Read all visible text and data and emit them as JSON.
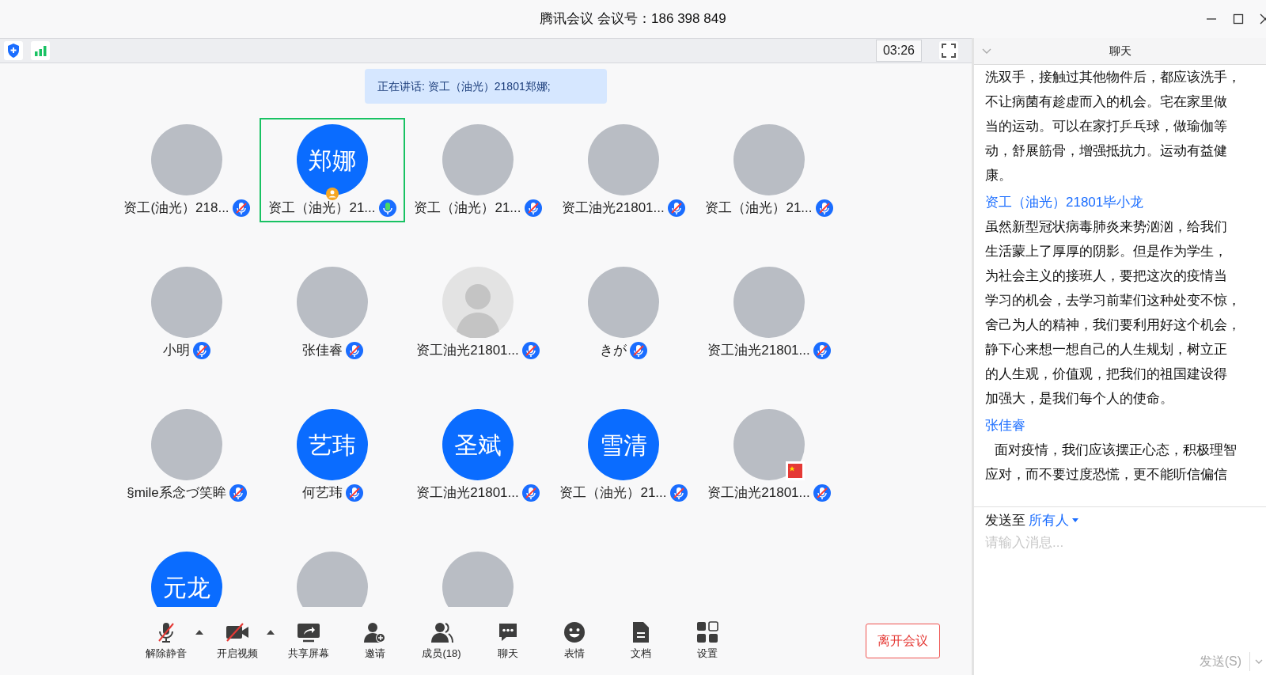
{
  "window": {
    "title": "腾讯会议 会议号：186 398 849"
  },
  "status_bar": {
    "timer": "03:26"
  },
  "speaking_banner": "正在讲话: 资工（油光）21801郑娜;",
  "participants": [
    {
      "kind": "photo",
      "name": "资工(油光）218...",
      "muted": true,
      "selected": false,
      "host": false,
      "flag": false
    },
    {
      "kind": "initials",
      "initials": "郑娜",
      "name": "资工（油光）21...",
      "muted": false,
      "selected": true,
      "host": true,
      "flag": false
    },
    {
      "kind": "photo",
      "name": "资工（油光）21...",
      "muted": true,
      "selected": false,
      "host": false,
      "flag": false
    },
    {
      "kind": "photo",
      "name": "资工油光21801...",
      "muted": true,
      "selected": false,
      "host": false,
      "flag": false
    },
    {
      "kind": "photo",
      "name": "资工（油光）21...",
      "muted": true,
      "selected": false,
      "host": false,
      "flag": false
    },
    {
      "kind": "photo",
      "name": "小明",
      "muted": true,
      "selected": false,
      "host": false,
      "flag": false
    },
    {
      "kind": "photo",
      "name": "张佳睿",
      "muted": true,
      "selected": false,
      "host": false,
      "flag": false
    },
    {
      "kind": "default",
      "name": "资工油光21801...",
      "muted": true,
      "selected": false,
      "host": false,
      "flag": false
    },
    {
      "kind": "photo",
      "name": "きが",
      "muted": true,
      "selected": false,
      "host": false,
      "flag": false
    },
    {
      "kind": "photo",
      "name": "资工油光21801...",
      "muted": true,
      "selected": false,
      "host": false,
      "flag": false
    },
    {
      "kind": "photo",
      "name": "§mile系念づ笑眸",
      "muted": true,
      "selected": false,
      "host": false,
      "flag": false
    },
    {
      "kind": "initials",
      "initials": "艺玮",
      "name": "何艺玮",
      "muted": true,
      "selected": false,
      "host": false,
      "flag": false
    },
    {
      "kind": "initials",
      "initials": "圣斌",
      "name": "资工油光21801...",
      "muted": true,
      "selected": false,
      "host": false,
      "flag": false
    },
    {
      "kind": "initials",
      "initials": "雪清",
      "name": "资工（油光）21...",
      "muted": true,
      "selected": false,
      "host": false,
      "flag": false
    },
    {
      "kind": "photo",
      "name": "资工油光21801...",
      "muted": true,
      "selected": false,
      "host": false,
      "flag": true
    },
    {
      "kind": "initials",
      "initials": "元龙",
      "selected": false,
      "host": false,
      "flag": false
    },
    {
      "kind": "photo",
      "selected": false,
      "host": false,
      "flag": false
    },
    {
      "kind": "photo",
      "selected": false,
      "host": false,
      "flag": false
    }
  ],
  "toolbar": [
    {
      "kind": "mic",
      "label": "解除静音",
      "caret": true
    },
    {
      "kind": "video",
      "label": "开启视频",
      "caret": true
    },
    {
      "kind": "share",
      "label": "共享屏幕",
      "caret": false
    },
    {
      "kind": "invite",
      "label": "邀请",
      "caret": false
    },
    {
      "kind": "members",
      "label": "成员(18)",
      "caret": false
    },
    {
      "kind": "chat",
      "label": "聊天",
      "caret": false
    },
    {
      "kind": "emoji",
      "label": "表情",
      "caret": false
    },
    {
      "kind": "doc",
      "label": "文档",
      "caret": false
    },
    {
      "kind": "settings",
      "label": "设置",
      "caret": false
    }
  ],
  "leave_button": "离开会议",
  "chat": {
    "title": "聊天",
    "messages": [
      {
        "lines": [
          "洗双手，接触过其他物件后，都应该洗手，",
          "不让病菌有趁虚而入的机会。宅在家里做",
          "当的运动。可以在家打乒乓球，做瑜伽等",
          "动，舒展筋骨，增强抵抗力。运动有益健",
          "康。"
        ]
      },
      {
        "sender": "资工（油光）21801毕小龙",
        "lines": [
          "虽然新型冠状病毒肺炎来势汹汹，给我们",
          "生活蒙上了厚厚的阴影。但是作为学生，",
          "为社会主义的接班人，要把这次的疫情当",
          "学习的机会，去学习前辈们这种处变不惊，",
          "舍己为人的精神，我们要利用好这个机会，",
          "静下心来想一想自己的人生规划，树立正",
          "的人生观，价值观，把我们的祖国建设得",
          "加强大，是我们每个人的使命。"
        ]
      },
      {
        "sender": "张佳睿",
        "lines": [
          "面对疫情，我们应该摆正心态，积极理智",
          "应对，而不要过度恐慌，更不能听信偏信"
        ]
      }
    ],
    "send_to_label": "发送至",
    "send_to_value": "所有人",
    "input": {
      "placeholder": "请输入消息..."
    },
    "send_button": "发送(S)"
  }
}
